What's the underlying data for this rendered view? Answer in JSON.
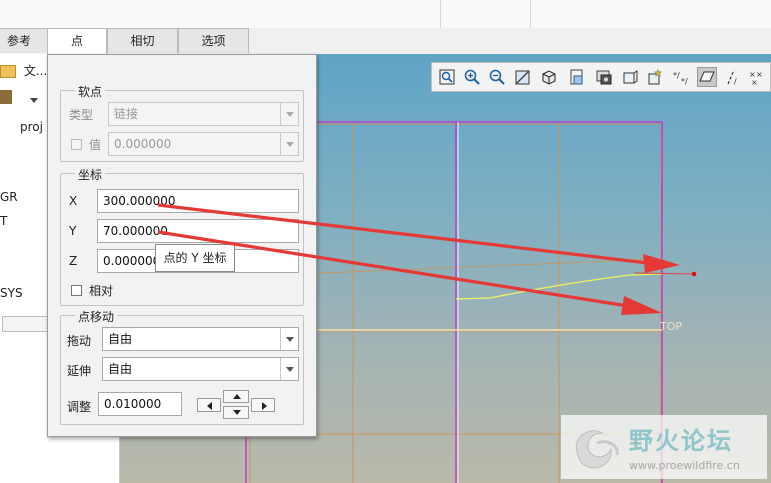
{
  "tabs": [
    {
      "label": "参考"
    },
    {
      "label": "点",
      "active": true
    },
    {
      "label": "相切"
    },
    {
      "label": "选项"
    }
  ],
  "left_panel": {
    "folder_label": "文...",
    "column_header": "proj",
    "tree_fragments": [
      "GR",
      "T",
      "SYS"
    ]
  },
  "dialog": {
    "soft_point": {
      "legend": "软点",
      "type_label": "类型",
      "type_value": "链接",
      "value_label": "值",
      "value_value": "0.000000"
    },
    "coords": {
      "legend": "坐标",
      "x_label": "X",
      "x_value": "300.000000",
      "y_label": "Y",
      "y_value": "70.000000",
      "z_label": "Z",
      "z_value": "0.000000",
      "relative_label": "相对"
    },
    "point_move": {
      "legend": "点移动",
      "drag_label": "拖动",
      "drag_value": "自由",
      "extend_label": "延伸",
      "extend_value": "自由",
      "adjust_label": "调整",
      "adjust_value": "0.010000"
    },
    "tooltip": "点的 Y 坐标"
  },
  "viewport": {
    "plane_label": "TOP",
    "toolbar_icons": [
      "zoom-fit-icon",
      "zoom-in-icon",
      "zoom-out-icon",
      "repaint-icon",
      "display-style-icon",
      "saved-views-icon",
      "view-manager-icon",
      "perspective-icon",
      "annotation-icon",
      "datum-display-icon",
      "plane-display-icon",
      "axis-display-icon",
      "point-display-icon"
    ]
  },
  "watermark": {
    "title": "野火论坛",
    "url": "www.proewildfire.cn"
  },
  "colors": {
    "arrow": "#e53935",
    "datum_magenta": "#c02ed3",
    "curve_yellow": "#f2f25a",
    "grid_orange": "#c8955a"
  }
}
